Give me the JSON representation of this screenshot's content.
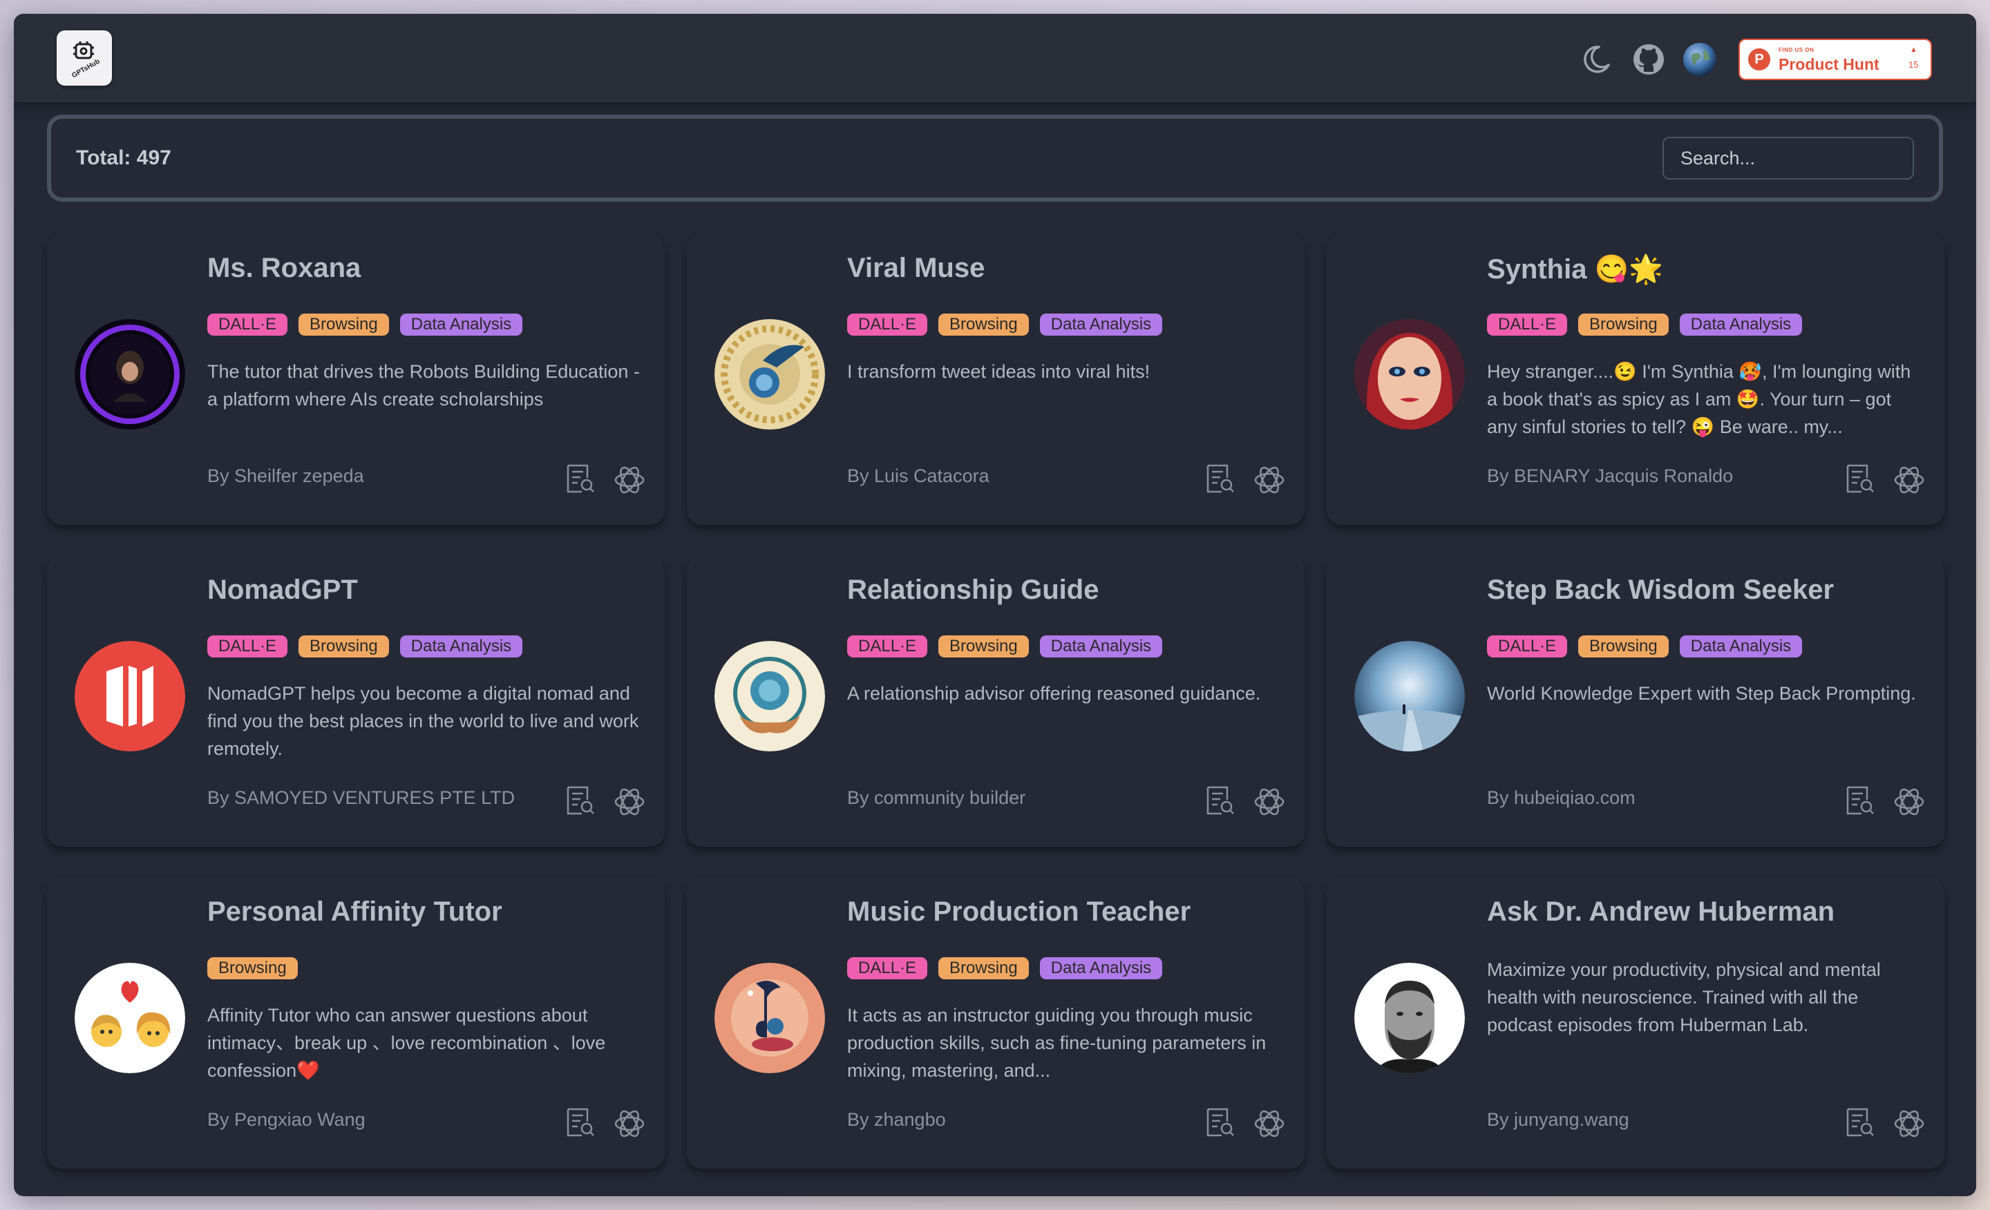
{
  "header": {
    "logo_text": "GPTsHub",
    "icons": [
      "moon-icon",
      "github-icon",
      "globe-icon"
    ],
    "product_hunt": {
      "small": "FIND US ON",
      "name": "Product Hunt",
      "count": "15"
    }
  },
  "toolbar": {
    "total_label": "Total: 497",
    "search_placeholder": "Search..."
  },
  "colors": {
    "dalle": "#ef5fb0",
    "browsing": "#f0a861",
    "data_analysis": "#b07ae8",
    "background": "#252936"
  },
  "cards": [
    {
      "title": "Ms. Roxana",
      "tags": [
        "DALL·E",
        "Browsing",
        "Data Analysis"
      ],
      "description": "The tutor that drives the Robots Building Education - a platform where AIs create scholarships",
      "author": "By Sheilfer zepeda"
    },
    {
      "title": "Viral Muse",
      "tags": [
        "DALL·E",
        "Browsing",
        "Data Analysis"
      ],
      "description": "I transform tweet ideas into viral hits!",
      "author": "By Luis Catacora"
    },
    {
      "title": "Synthia 😋🌟",
      "tags": [
        "DALL·E",
        "Browsing",
        "Data Analysis"
      ],
      "description": "Hey stranger....😉 I'm Synthia 🥵, I'm lounging with a book that's as spicy as I am 🤩. Your turn – got any sinful stories to tell? 😜 Be ware.. my...",
      "author": "By BENARY Jacquis Ronaldo"
    },
    {
      "title": "NomadGPT",
      "tags": [
        "DALL·E",
        "Browsing",
        "Data Analysis"
      ],
      "description": "NomadGPT helps you become a digital nomad and find you the best places in the world to live and work remotely.",
      "author": "By SAMOYED VENTURES PTE LTD"
    },
    {
      "title": "Relationship Guide",
      "tags": [
        "DALL·E",
        "Browsing",
        "Data Analysis"
      ],
      "description": "A relationship advisor offering reasoned guidance.",
      "author": "By community builder"
    },
    {
      "title": "Step Back Wisdom Seeker",
      "tags": [
        "DALL·E",
        "Browsing",
        "Data Analysis"
      ],
      "description": "World Knowledge Expert with Step Back Prompting.",
      "author": "By hubeiqiao.com"
    },
    {
      "title": "Personal Affinity Tutor",
      "tags": [
        "Browsing"
      ],
      "description": "Affinity Tutor who can answer questions about intimacy、break up 、love recombination 、love confession❤️",
      "author": "By Pengxiao Wang"
    },
    {
      "title": "Music Production Teacher",
      "tags": [
        "DALL·E",
        "Browsing",
        "Data Analysis"
      ],
      "description": "It acts as an instructor guiding you through music production skills, such as fine-tuning parameters in mixing, mastering, and...",
      "author": "By zhangbo"
    },
    {
      "title": "Ask Dr. Andrew Huberman",
      "tags": [],
      "description": "Maximize your productivity, physical and mental health with neuroscience. Trained with all the podcast episodes from Huberman Lab.",
      "author": "By junyang.wang"
    }
  ]
}
